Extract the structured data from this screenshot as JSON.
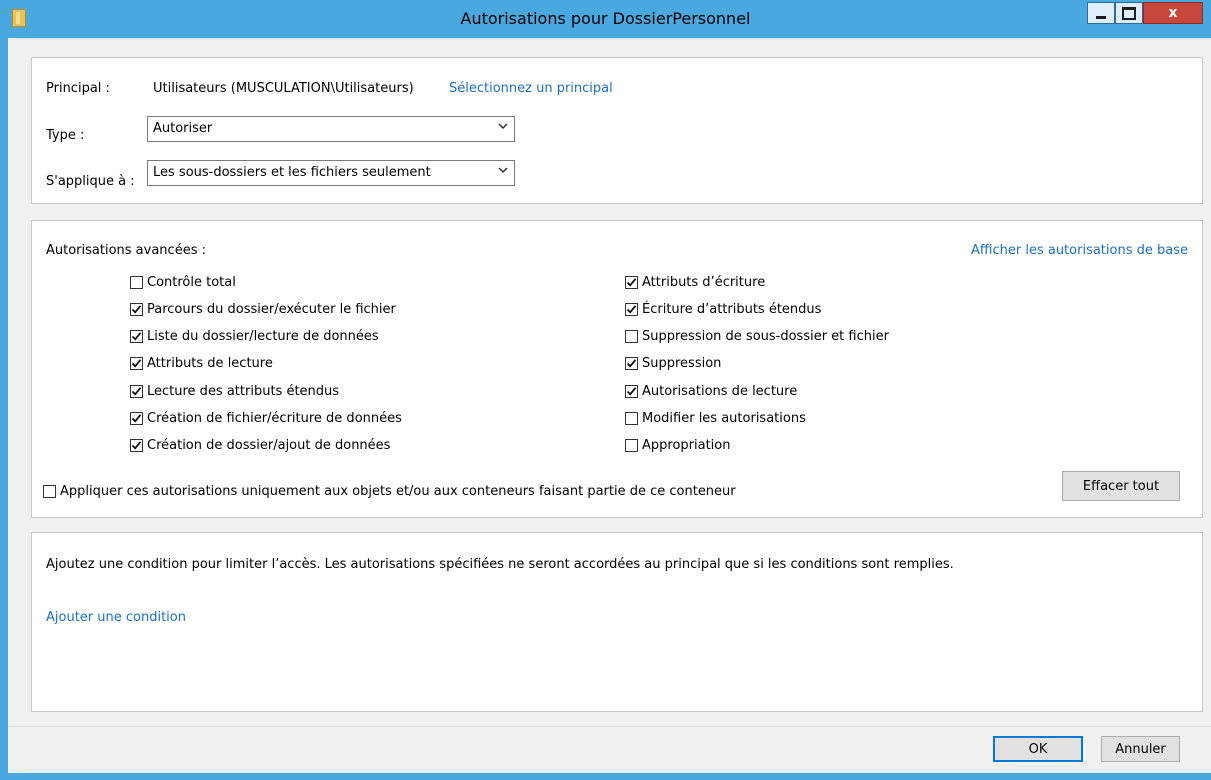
{
  "window": {
    "title": "Autorisations pour DossierPersonnel",
    "close_label": "x"
  },
  "principal": {
    "label": "Principal :",
    "value": "Utilisateurs (MUSCULATION\\Utilisateurs)",
    "link": "Sélectionnez un principal"
  },
  "type": {
    "label": "Type :",
    "value": "Autoriser"
  },
  "applies": {
    "label": "S'applique à :",
    "value": "Les sous-dossiers et les fichiers seulement"
  },
  "advanced": {
    "heading": "Autorisations avancées :",
    "show_basic_link": "Afficher les autorisations de base",
    "left": [
      {
        "label": "Contrôle total",
        "checked": false
      },
      {
        "label": "Parcours du dossier/exécuter le fichier",
        "checked": true
      },
      {
        "label": "Liste du dossier/lecture de données",
        "checked": true
      },
      {
        "label": "Attributs de lecture",
        "checked": true
      },
      {
        "label": "Lecture des attributs étendus",
        "checked": true
      },
      {
        "label": "Création de fichier/écriture de données",
        "checked": true
      },
      {
        "label": "Création de dossier/ajout de données",
        "checked": true
      }
    ],
    "right": [
      {
        "label": "Attributs d’écriture",
        "checked": true
      },
      {
        "label": "Écriture d’attributs étendus",
        "checked": true
      },
      {
        "label": "Suppression de sous-dossier et fichier",
        "checked": false
      },
      {
        "label": "Suppression",
        "checked": true
      },
      {
        "label": "Autorisations de lecture",
        "checked": true
      },
      {
        "label": "Modifier les autorisations",
        "checked": false
      },
      {
        "label": "Appropriation",
        "checked": false
      }
    ],
    "apply_only": {
      "label": "Appliquer ces autorisations uniquement aux objets et/ou aux conteneurs faisant partie de ce conteneur",
      "checked": false
    },
    "clear_all": "Effacer tout"
  },
  "condition": {
    "text": "Ajoutez une condition pour limiter l’accès. Les autorisations spécifiées ne seront accordées au principal que si les conditions sont remplies.",
    "add_link": "Ajouter une condition"
  },
  "footer": {
    "ok": "OK",
    "cancel": "Annuler"
  },
  "colors": {
    "title_bar": "#4aa8e0",
    "link": "#1a70c2",
    "close_button": "#c7463e"
  }
}
